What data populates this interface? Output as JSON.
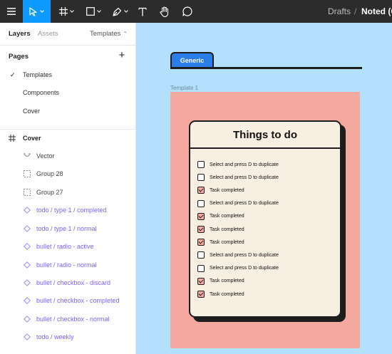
{
  "toolbar": {
    "tools": [
      {
        "name": "main-menu",
        "icon": "hamburger-icon"
      },
      {
        "name": "move-tool",
        "icon": "cursor-icon",
        "active": true
      },
      {
        "name": "frame-tool",
        "icon": "hash-icon"
      },
      {
        "name": "shape-tool",
        "icon": "rectangle-icon"
      },
      {
        "name": "pen-tool",
        "icon": "pen-icon"
      },
      {
        "name": "text-tool",
        "icon": "text-icon"
      },
      {
        "name": "hand-tool",
        "icon": "hand-icon"
      },
      {
        "name": "comment-tool",
        "icon": "comment-icon"
      }
    ],
    "breadcrumb_location": "Drafts",
    "breadcrumb_separator": "/",
    "file_name": "Noted (C"
  },
  "panel": {
    "tabs": {
      "layers": "Layers",
      "assets": "Assets",
      "templates": "Templates"
    },
    "pages_title": "Pages",
    "pages": [
      {
        "label": "Templates",
        "selected": true
      },
      {
        "label": "Components",
        "selected": false
      },
      {
        "label": "Cover",
        "selected": false
      }
    ],
    "frame_name": "Cover",
    "layers": [
      {
        "label": "Vector",
        "type": "vector"
      },
      {
        "label": "Group 28",
        "type": "group"
      },
      {
        "label": "Group 27",
        "type": "group"
      },
      {
        "label": "todo / type 1 / completed",
        "type": "component"
      },
      {
        "label": "todo / type 1 / normal",
        "type": "component"
      },
      {
        "label": "bullet / radio - active",
        "type": "component"
      },
      {
        "label": "bullet / radio - normal",
        "type": "component"
      },
      {
        "label": "bullet / checkbox - discard",
        "type": "component"
      },
      {
        "label": "bullet / checkbox - completed",
        "type": "component"
      },
      {
        "label": "bullet / checkbox - normal",
        "type": "component"
      },
      {
        "label": "todo / weekly",
        "type": "component"
      }
    ]
  },
  "canvas": {
    "tab_label": "Generic",
    "frame_label": "Template 1",
    "card_title": "Things to do",
    "todos": [
      {
        "text": "Select and press  D to duplicate",
        "done": false
      },
      {
        "text": "Select and press  D to duplicate",
        "done": false
      },
      {
        "text": "Task completed",
        "done": true
      },
      {
        "text": "Select and press  D to duplicate",
        "done": false
      },
      {
        "text": "Task completed",
        "done": true
      },
      {
        "text": "Task completed",
        "done": true
      },
      {
        "text": "Task completed",
        "done": true
      },
      {
        "text": "Select and press  D to duplicate",
        "done": false
      },
      {
        "text": "Select and press  D to duplicate",
        "done": false
      },
      {
        "text": "Task completed",
        "done": true
      },
      {
        "text": "Task completed",
        "done": true
      }
    ]
  },
  "colors": {
    "toolbar_bg": "#2c2c2c",
    "accent": "#0d99ff",
    "canvas_bg": "#b3e0fd",
    "template_bg": "#f4a9a0",
    "card_bg": "#f7efe2",
    "component": "#7b61ff",
    "tab_blue": "#2b7de9"
  }
}
